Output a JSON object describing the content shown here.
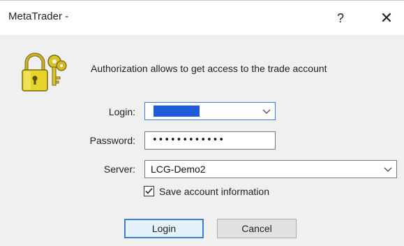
{
  "window": {
    "title": "MetaTrader -",
    "help_label": "?",
    "close_label": "✕"
  },
  "icons": {
    "lock": "lock-keys-icon",
    "dropdown": "chevron-down-icon",
    "check": "checkmark-icon"
  },
  "auth": {
    "message": "Authorization allows to get access to the trade account"
  },
  "form": {
    "login_label": "Login:",
    "login_value_redacted": true,
    "password_label": "Password:",
    "password_value": "••••••••••••",
    "server_label": "Server:",
    "server_value": "LCG-Demo2",
    "save_info_label": "Save account information",
    "save_info_checked": true
  },
  "buttons": {
    "login": "Login",
    "cancel": "Cancel"
  },
  "colors": {
    "accent": "#3a7fd5",
    "redaction": "#1f5bd8",
    "lock_gold": "#d8c21f"
  }
}
